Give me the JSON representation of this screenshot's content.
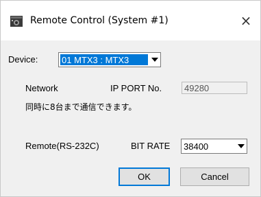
{
  "window": {
    "title": "Remote Control (System #1)",
    "close_glyph": "×",
    "icon": "app-icon"
  },
  "device": {
    "label": "Device:",
    "selected": "01 MTX3 : MTX3"
  },
  "network": {
    "label": "Network",
    "ip_port_label": "IP PORT No.",
    "ip_port_value": "49280",
    "note": "同時に8台まで通信できます。"
  },
  "remote": {
    "label": "Remote(RS-232C)",
    "bit_rate_label": "BIT RATE",
    "bit_rate_selected": "38400"
  },
  "buttons": {
    "ok": "OK",
    "cancel": "Cancel"
  },
  "colors": {
    "selection": "#0078d7",
    "dialog_bg": "#f0f0f0",
    "titlebar_bg": "#ffffff"
  }
}
